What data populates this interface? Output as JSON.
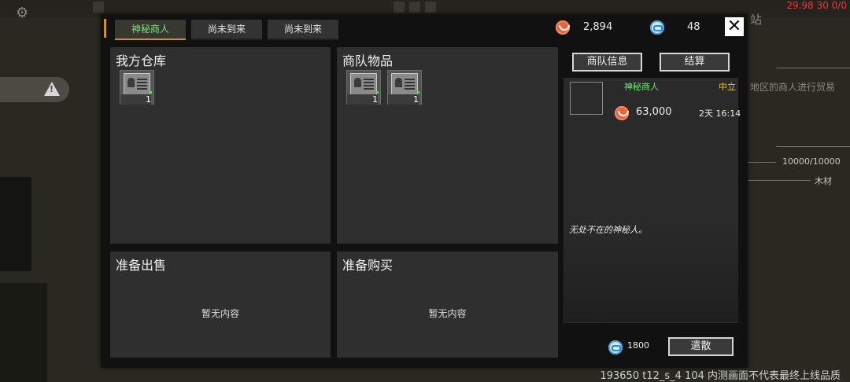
{
  "background": {
    "top_status": "29.98 30 0/0",
    "right_hint": "地区的商人进行贸易",
    "right_station_char": "站",
    "capacity": "10000/10000",
    "resource_label": "木材",
    "build_info": "193650 t12_s_4 104  内测画面不代表最终上线品质"
  },
  "tabs": [
    "神秘商人",
    "尚未到来",
    "尚未到来"
  ],
  "currency": {
    "copper": "2,894",
    "coin": "48"
  },
  "panels": {
    "my_warehouse": {
      "title": "我方仓库",
      "items": [
        {
          "count": "1"
        }
      ]
    },
    "caravan_goods": {
      "title": "商队物品",
      "items": [
        {
          "count": "1"
        },
        {
          "count": "1"
        }
      ]
    },
    "to_sell": {
      "title": "准备出售",
      "empty": "暂无内容"
    },
    "to_buy": {
      "title": "准备购买",
      "empty": "暂无内容"
    }
  },
  "sidebar": {
    "info_button": "商队信息",
    "settle_button": "结算",
    "merchant_name": "神秘商人",
    "stance": "中立",
    "funds": "63,000",
    "time_left": "2天 16:14",
    "description": "无处不在的神秘人。",
    "dismiss_cost": "1800",
    "dismiss_button": "遣散"
  },
  "colors": {
    "accent": "#c9912d",
    "merchant_green": "#7be27b",
    "stance_yellow": "#e2c33a",
    "copper": "#e9643a",
    "coin": "#4aa4e4"
  }
}
